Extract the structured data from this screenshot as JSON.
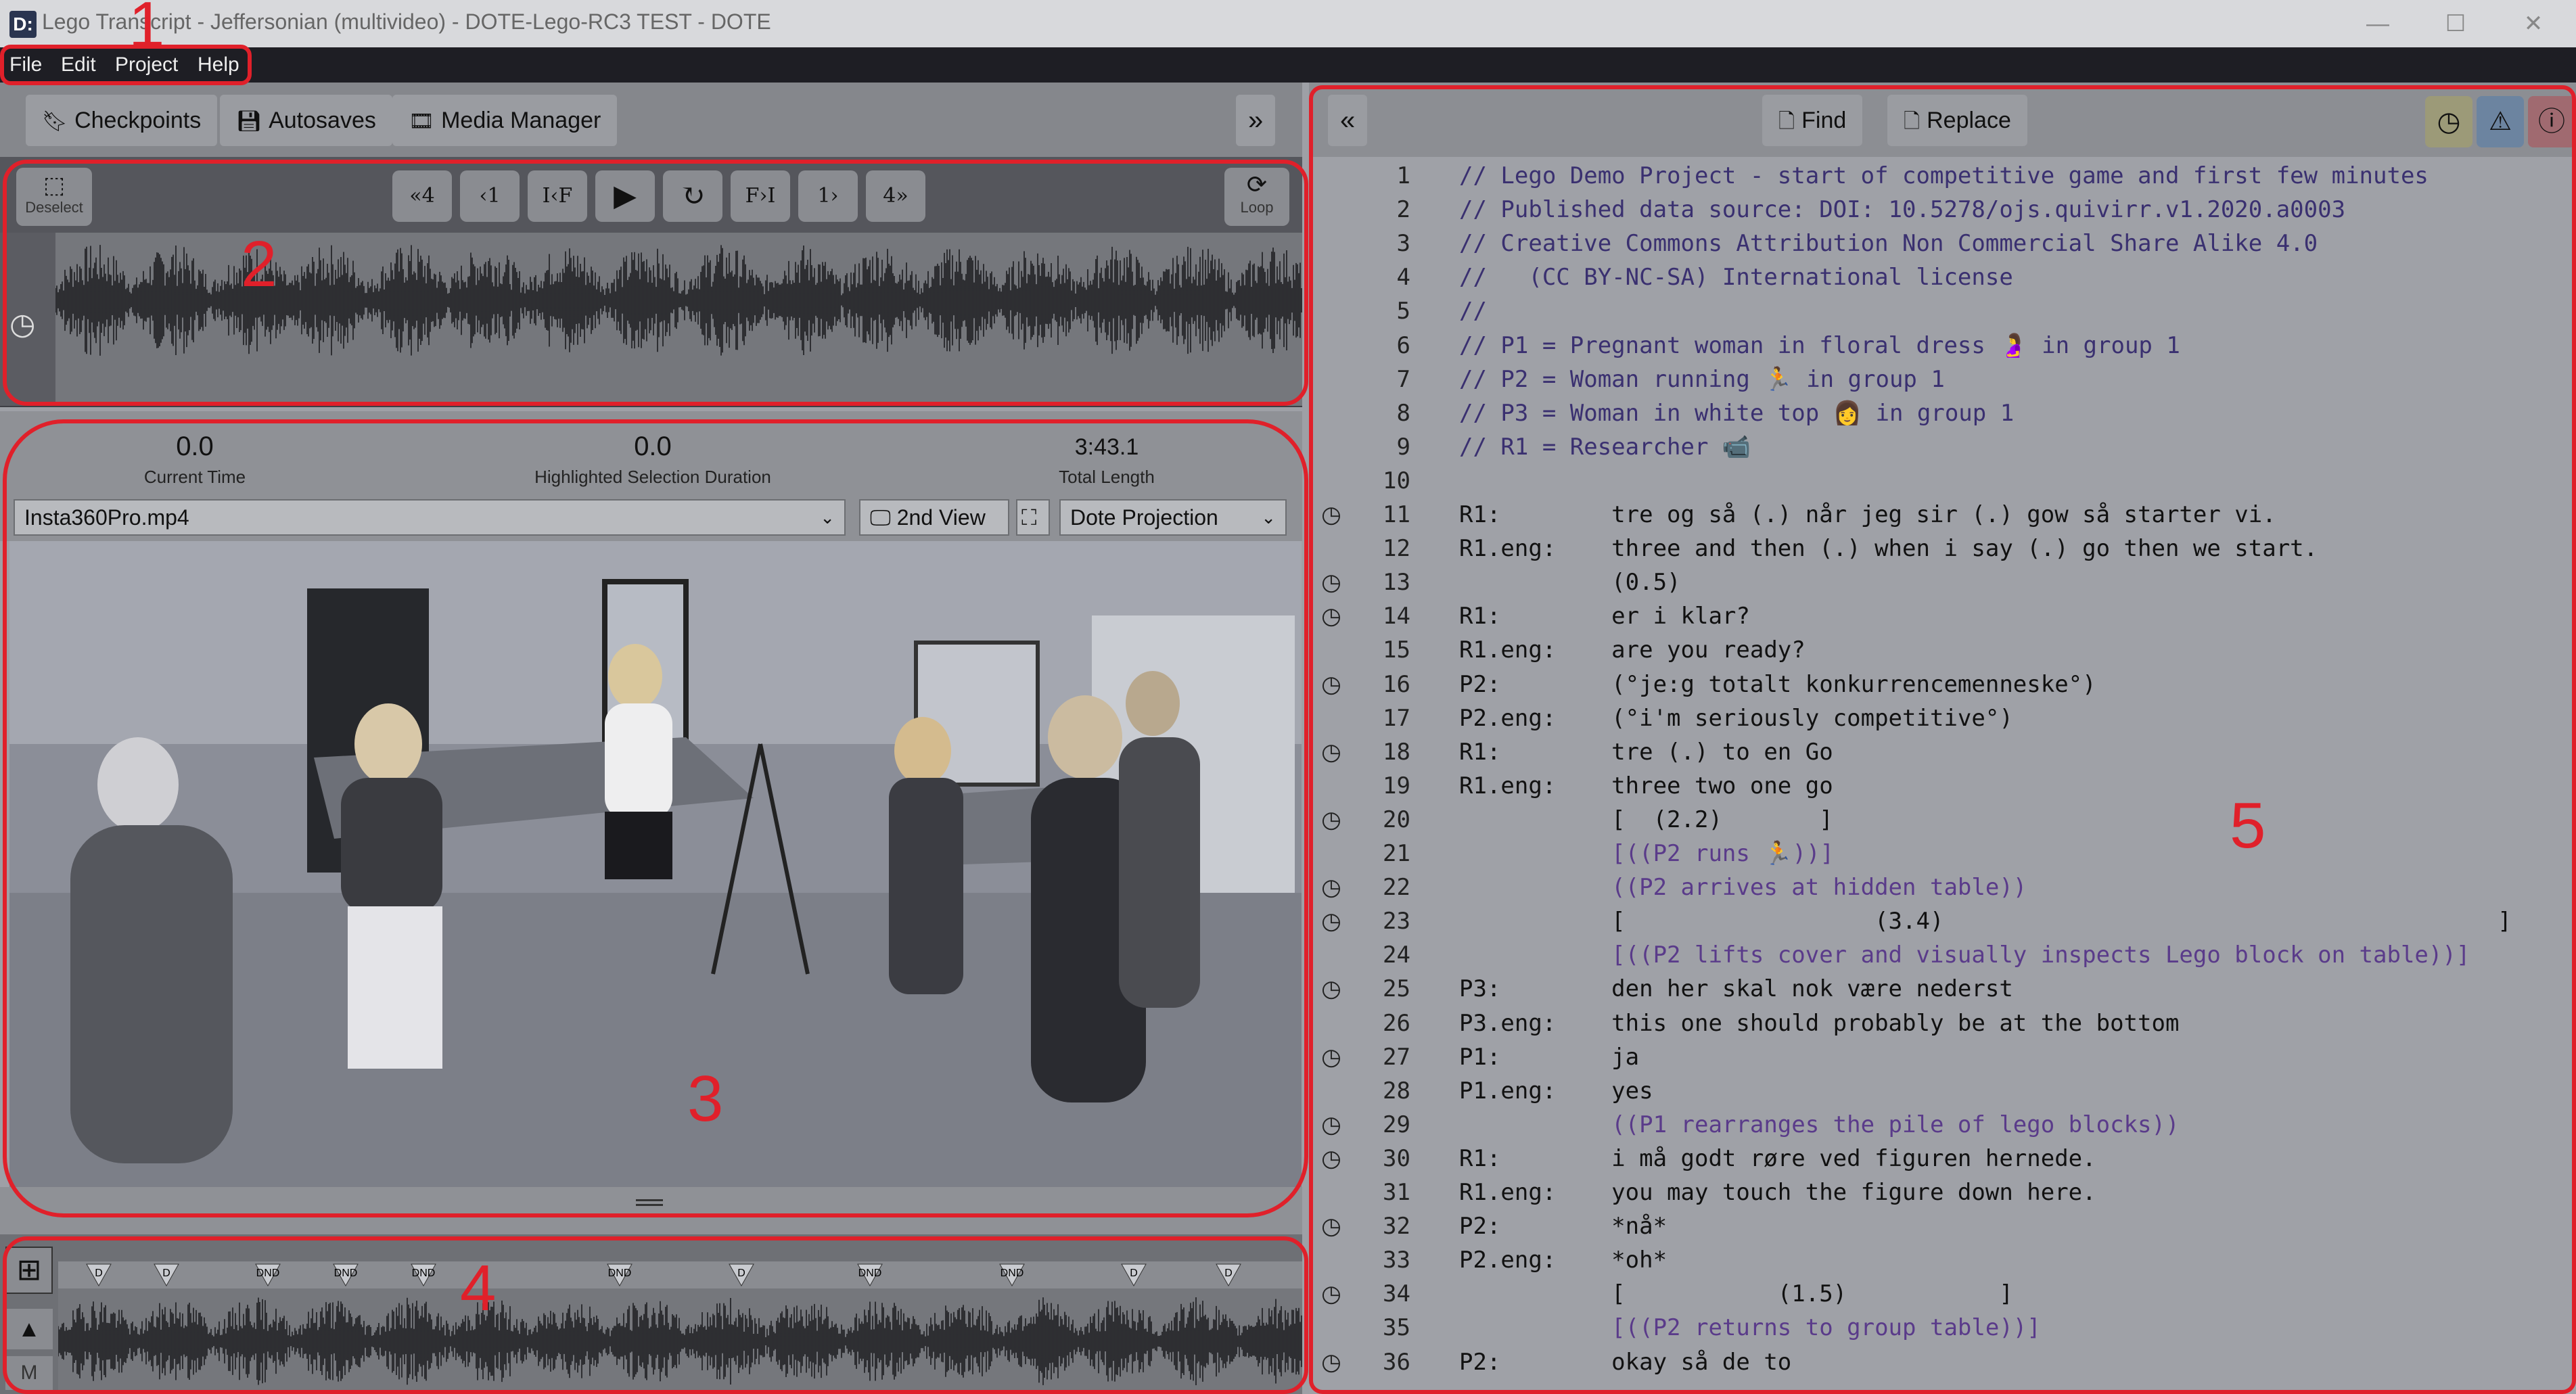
{
  "window": {
    "title": "Lego Transcript - Jeffersonian (multivideo) - DOTE-Lego-RC3 TEST - DOTE",
    "app_icon": "D:",
    "controls": [
      "—",
      "☐",
      "✕"
    ]
  },
  "menu": [
    "File",
    "Edit",
    "Project",
    "Help"
  ],
  "left_toolbar": {
    "checkpoints": "Checkpoints",
    "autosaves": "Autosaves",
    "media_manager": "Media Manager",
    "expand": "»"
  },
  "player": {
    "deselect": "Deselect",
    "buttons": [
      "«4",
      "‹1",
      "I‹F",
      "▶",
      "↻",
      "F›I",
      "1›",
      "4»"
    ],
    "loop": "Loop"
  },
  "info": {
    "current_time_value": "0.0",
    "current_time_label": "Current Time",
    "highlight_value": "0.0",
    "highlight_label": "Highlighted Selection Duration",
    "total_value": "3:43.1",
    "total_label": "Total Length",
    "video_file": "Insta360Pro.mp4",
    "second_view": "2nd View",
    "projection": "Dote Projection"
  },
  "timeline": {
    "marker_labels": [
      "D",
      "D",
      "DND",
      "DND",
      "DND",
      "DND",
      "D",
      "DND",
      "DND",
      "D",
      "D"
    ],
    "mode_label": "M"
  },
  "editor_toolbar": {
    "collapse": "«",
    "find": "Find",
    "replace": "Replace"
  },
  "annotations": [
    "1",
    "2",
    "3",
    "4",
    "5"
  ],
  "transcript": [
    {
      "n": "1",
      "text": "// Lego Demo Project - start of competitive game and first few minutes",
      "kind": "comment",
      "clock": false
    },
    {
      "n": "2",
      "text": "// Published data source: DOI: 10.5278/ojs.quivirr.v1.2020.a0003",
      "kind": "comment",
      "clock": false
    },
    {
      "n": "3",
      "text": "// Creative Commons Attribution Non Commercial Share Alike 4.0",
      "kind": "comment",
      "clock": false
    },
    {
      "n": "4",
      "text": "//   (CC BY-NC-SA) International license",
      "kind": "comment",
      "clock": false
    },
    {
      "n": "5",
      "text": "//",
      "kind": "comment",
      "clock": false
    },
    {
      "n": "6",
      "text": "// P1 = Pregnant woman in floral dress 🤰 in group 1",
      "kind": "comment",
      "clock": false
    },
    {
      "n": "7",
      "text": "// P2 = Woman running 🏃 in group 1",
      "kind": "comment",
      "clock": false
    },
    {
      "n": "8",
      "text": "// P3 = Woman in white top 👩 in group 1",
      "kind": "comment",
      "clock": false
    },
    {
      "n": "9",
      "text": "// R1 = Researcher 📹",
      "kind": "comment",
      "clock": false
    },
    {
      "n": "10",
      "text": "",
      "kind": "plain",
      "clock": false
    },
    {
      "n": "11",
      "text": "R1:        tre og så (.) når jeg sir (.) gow så starter vi.",
      "kind": "plain",
      "clock": true
    },
    {
      "n": "12",
      "text": "R1.eng:    three and then (.) when i say (.) go then we start.",
      "kind": "plain",
      "clock": false
    },
    {
      "n": "13",
      "text": "           (0.5)",
      "kind": "plain",
      "clock": true
    },
    {
      "n": "14",
      "text": "R1:        er i klar?",
      "kind": "plain",
      "clock": true
    },
    {
      "n": "15",
      "text": "R1.eng:    are you ready?",
      "kind": "plain",
      "clock": false
    },
    {
      "n": "16",
      "text": "P2:        (°je:g totalt konkurrencemenneske°)",
      "kind": "plain",
      "clock": true
    },
    {
      "n": "17",
      "text": "P2.eng:    (°i'm seriously competitive°)",
      "kind": "plain",
      "clock": false
    },
    {
      "n": "18",
      "text": "R1:        tre (.) to en Go",
      "kind": "plain",
      "clock": true
    },
    {
      "n": "19",
      "text": "R1.eng:    three two one go",
      "kind": "plain",
      "clock": false
    },
    {
      "n": "20",
      "text": "           [  (2.2)       ]",
      "kind": "plain",
      "clock": true
    },
    {
      "n": "21",
      "text": "           [((P2 runs 🏃))]",
      "kind": "action",
      "clock": false
    },
    {
      "n": "22",
      "text": "           ((P2 arrives at hidden table))",
      "kind": "action",
      "clock": true
    },
    {
      "n": "23",
      "text": "           [                  (3.4)                                        ]",
      "kind": "plain",
      "clock": true
    },
    {
      "n": "24",
      "text": "           [((P2 lifts cover and visually inspects Lego block on table))]",
      "kind": "action",
      "clock": false
    },
    {
      "n": "25",
      "text": "P3:        den her skal nok være nederst",
      "kind": "plain",
      "clock": true
    },
    {
      "n": "26",
      "text": "P3.eng:    this one should probably be at the bottom",
      "kind": "plain",
      "clock": false
    },
    {
      "n": "27",
      "text": "P1:        ja",
      "kind": "plain",
      "clock": true
    },
    {
      "n": "28",
      "text": "P1.eng:    yes",
      "kind": "plain",
      "clock": false
    },
    {
      "n": "29",
      "text": "           ((P1 rearranges the pile of lego blocks))",
      "kind": "action",
      "clock": true
    },
    {
      "n": "30",
      "text": "R1:        i må godt røre ved figuren hernede.",
      "kind": "plain",
      "clock": true
    },
    {
      "n": "31",
      "text": "R1.eng:    you may touch the figure down here.",
      "kind": "plain",
      "clock": false
    },
    {
      "n": "32",
      "text": "P2:        *nå*",
      "kind": "plain",
      "clock": true
    },
    {
      "n": "33",
      "text": "P2.eng:    *oh*",
      "kind": "plain",
      "clock": false
    },
    {
      "n": "34",
      "text": "           [           (1.5)           ]",
      "kind": "plain",
      "clock": true
    },
    {
      "n": "35",
      "text": "           [((P2 returns to group table))]",
      "kind": "action",
      "clock": false
    },
    {
      "n": "36",
      "text": "P2:        okay så de to",
      "kind": "plain",
      "clock": true
    }
  ],
  "colors": {
    "annotation_red": "#e0202a",
    "comment": "#3a3070",
    "action": "#5a3b8a",
    "menubar": "#1e1e24"
  }
}
